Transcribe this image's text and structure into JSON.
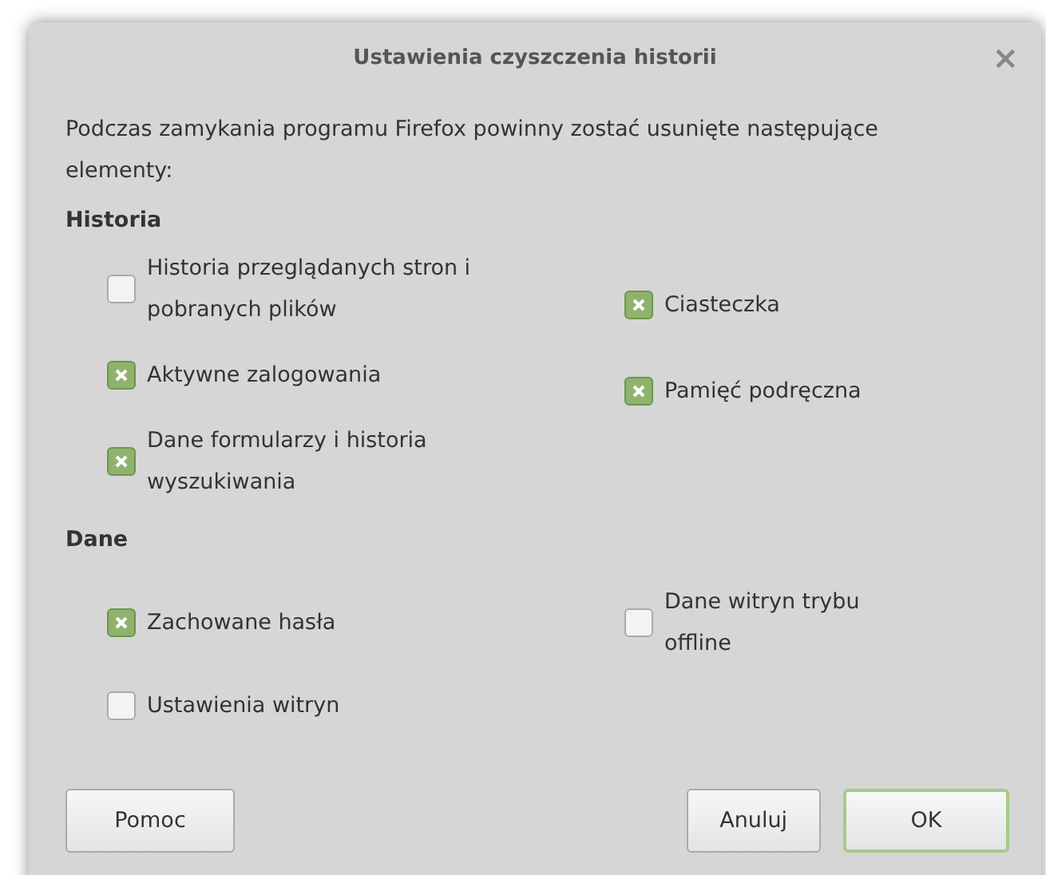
{
  "window": {
    "title": "Ustawienia czyszczenia historii",
    "close": "×"
  },
  "intro": "Podczas zamykania programu Firefox powinny zostać usunięte następujące elementy:",
  "sections": [
    {
      "heading": "Historia",
      "left": [
        {
          "label": "Historia przeglądanych stron i pobranych plików",
          "checked": false
        },
        {
          "label": "Aktywne zalogowania",
          "checked": true
        },
        {
          "label": "Dane formularzy i historia wyszukiwania",
          "checked": true
        }
      ],
      "right": [
        {
          "label": "Ciasteczka",
          "checked": true
        },
        {
          "label": "Pamięć podręczna",
          "checked": true
        }
      ]
    },
    {
      "heading": "Dane",
      "left": [
        {
          "label": "Zachowane hasła",
          "checked": true
        },
        {
          "label": "Ustawienia witryn",
          "checked": false
        }
      ],
      "right": [
        {
          "label": "Dane witryn trybu offline",
          "checked": false
        }
      ]
    }
  ],
  "buttons": [
    {
      "label": "Pomoc",
      "default": false
    },
    {
      "label": "Anuluj",
      "default": false
    },
    {
      "label": "OK",
      "default": true
    }
  ]
}
